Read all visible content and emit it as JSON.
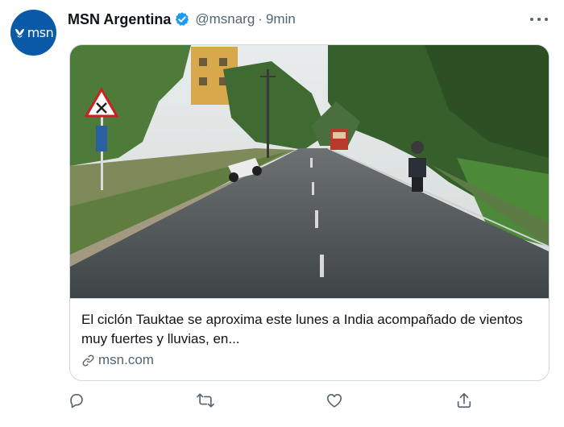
{
  "author": {
    "avatar_text": "msn",
    "avatar_icon": "msn-butterfly-logo",
    "name": "MSN Argentina",
    "verified_icon": "verified-badge-icon",
    "handle": "@msnarg",
    "separator": "·",
    "timestamp": "9min"
  },
  "menu_icon": "more-options-icon",
  "card": {
    "title": "El ciclón Tauktae se aproxima este lunes a India acompañado de vientos muy fuertes y lluvias, en...",
    "domain": "msn.com",
    "domain_icon": "link-icon"
  },
  "actions": [
    "reply-icon",
    "retweet-icon",
    "like-icon",
    "share-icon"
  ],
  "colors": {
    "brand": "#0a5aa8",
    "verified": "#1d9bf0",
    "secondary_text": "#536471",
    "border": "#cfd9de"
  }
}
